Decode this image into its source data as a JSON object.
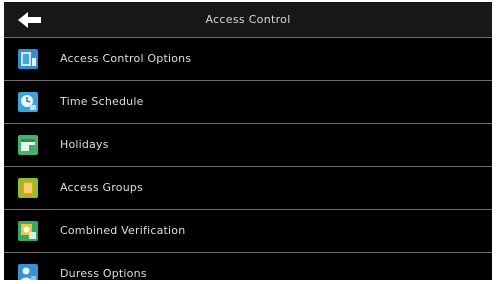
{
  "header": {
    "title": "Access Control",
    "back_icon": "back-arrow-icon"
  },
  "menu": {
    "items": [
      {
        "label": "Access Control Options",
        "icon": "access-control-options-icon",
        "color": "#2f8fcf"
      },
      {
        "label": "Time Schedule",
        "icon": "time-schedule-icon",
        "color": "#3aa6d8"
      },
      {
        "label": "Holidays",
        "icon": "holidays-icon",
        "color": "#45b36f"
      },
      {
        "label": "Access Groups",
        "icon": "access-groups-icon",
        "color": "#8fbf2f"
      },
      {
        "label": "Combined Verification",
        "icon": "combined-verification-icon",
        "color": "#39a865"
      },
      {
        "label": "Duress Options",
        "icon": "duress-options-icon",
        "color": "#3d8fd0"
      }
    ]
  },
  "colors": {
    "background": "#000000",
    "header_background": "#171717",
    "text": "#dedede",
    "divider": "#6e6e6e"
  }
}
